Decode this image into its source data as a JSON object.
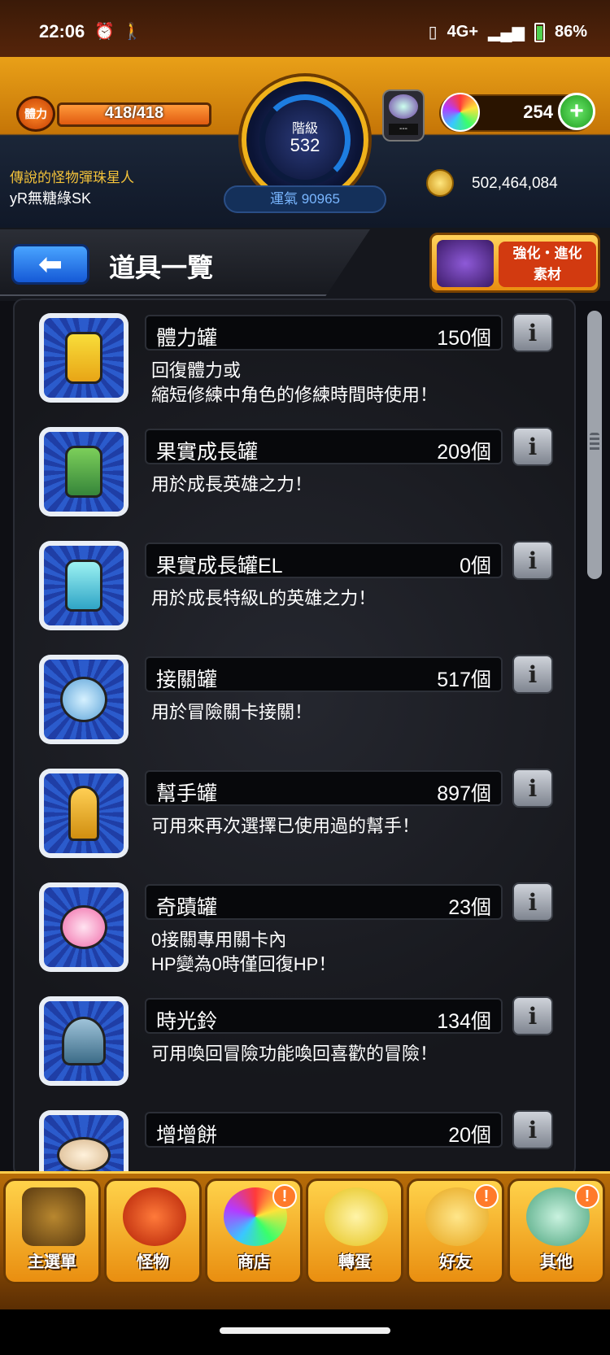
{
  "status_bar": {
    "time": "22:06",
    "network": "4G+",
    "battery": "86%"
  },
  "header": {
    "stamina_icon_label": "體力",
    "stamina": "418/418",
    "stamina_fraction": 1.0,
    "rank_label": "階級",
    "rank_value": "532",
    "orbs": "254",
    "plus_label": "+",
    "player_title": "傳說的怪物彈珠星人",
    "player_name": "yR無糖綠SK",
    "luck": "運氣 90965",
    "coins": "502,464,084",
    "stamina_obj_label": "---"
  },
  "titlebar": {
    "back_label": "⬅",
    "title": "道具一覽",
    "evo_button_label": "強化・進化\n素材"
  },
  "items": [
    {
      "name": "體力罐",
      "count": "150個",
      "desc": "回復體力或\n縮短修練中角色的修練時間時使用！",
      "icon": "can"
    },
    {
      "name": "果實成長罐",
      "count": "209個",
      "desc": "用於成長英雄之力！",
      "icon": "bottle"
    },
    {
      "name": "果實成長罐EL",
      "count": "0個",
      "desc": "用於成長特級L的英雄之力！",
      "icon": "bottle-el"
    },
    {
      "name": "接關罐",
      "count": "517個",
      "desc": "用於冒險關卡接關！",
      "icon": "jar"
    },
    {
      "name": "幫手罐",
      "count": "897個",
      "desc": "可用來再次選擇已使用過的幫手！",
      "icon": "helper"
    },
    {
      "name": "奇蹟罐",
      "count": "23個",
      "desc": "0接關專用關卡內\nHP變為0時僅回復HP！",
      "icon": "miracle"
    },
    {
      "name": "時光鈴",
      "count": "134個",
      "desc": "可用喚回冒險功能喚回喜歡的冒險！",
      "icon": "bell"
    },
    {
      "name": "增增餅",
      "count": "20個",
      "desc": "",
      "icon": "mochi"
    }
  ],
  "info_button_label": "i",
  "bottom_nav": [
    {
      "label": "主選單",
      "icon": "home-icon",
      "badge": ""
    },
    {
      "label": "怪物",
      "icon": "monster-icon",
      "badge": ""
    },
    {
      "label": "商店",
      "icon": "shop-icon",
      "badge": "!"
    },
    {
      "label": "轉蛋",
      "icon": "egg-icon",
      "badge": ""
    },
    {
      "label": "好友",
      "icon": "friend-icon",
      "badge": "!"
    },
    {
      "label": "其他",
      "icon": "other-icon",
      "badge": "!"
    }
  ]
}
